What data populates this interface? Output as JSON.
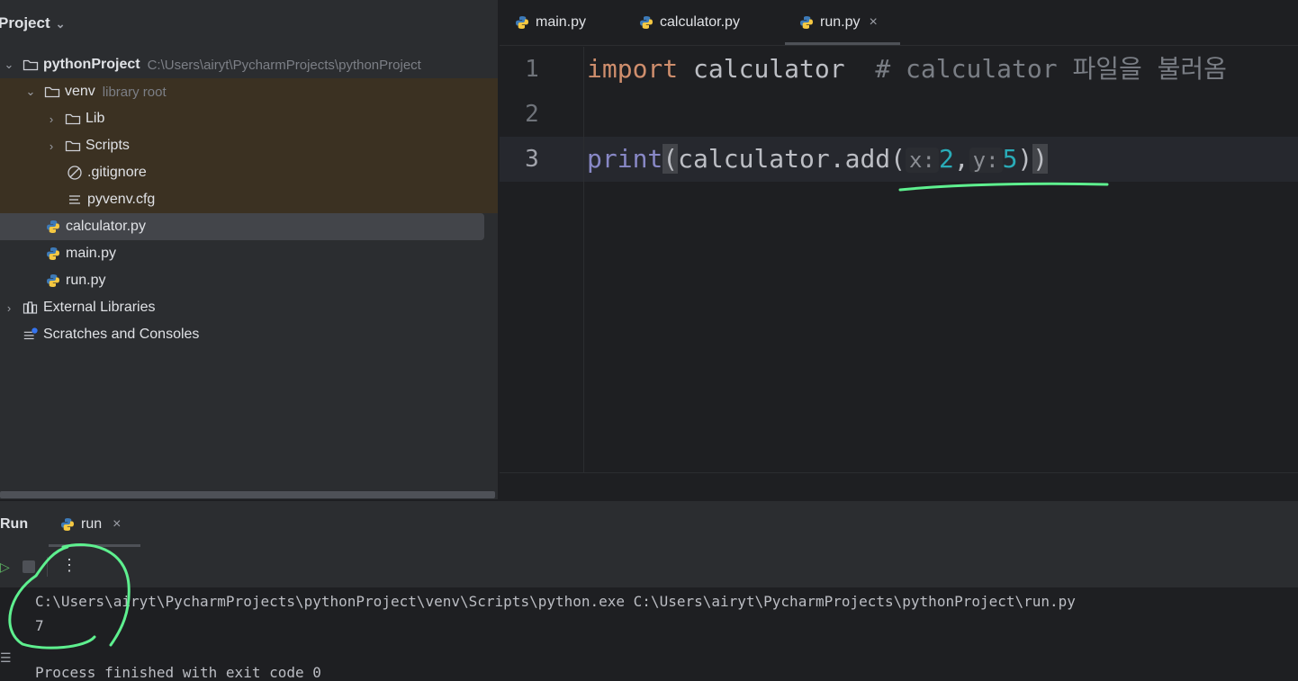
{
  "project_panel": {
    "title": "Project",
    "tree": {
      "root_name": "pythonProject",
      "root_path": "C:\\Users\\airyt\\PycharmProjects\\pythonProject",
      "venv_name": "venv",
      "venv_note": "library root",
      "lib": "Lib",
      "scripts": "Scripts",
      "gitignore": ".gitignore",
      "pyvenv": "pyvenv.cfg",
      "calculator": "calculator.py",
      "main": "main.py",
      "run": "run.py",
      "external_libraries": "External Libraries",
      "scratches": "Scratches and Consoles"
    }
  },
  "editor": {
    "tabs": [
      "main.py",
      "calculator.py",
      "run.py"
    ],
    "active_tab": "run.py",
    "line_numbers": [
      "1",
      "2",
      "3"
    ],
    "code": {
      "line1_keyword": "import",
      "line1_module": " calculator  ",
      "line1_comment": "# calculator 파일을 불러옴",
      "line3_print": "print",
      "line3_open": "(",
      "line3_call": "calculator.add(",
      "line3_hint_x": "x:",
      "line3_arg1": "2",
      "line3_comma": ",",
      "line3_hint_y": "y:",
      "line3_arg2": "5",
      "line3_close1": ")",
      "line3_close2": ")"
    }
  },
  "run_panel": {
    "title": "Run",
    "tab_label": "run",
    "more_label": "⋮",
    "console_lines": [
      "C:\\Users\\airyt\\PycharmProjects\\pythonProject\\venv\\Scripts\\python.exe C:\\Users\\airyt\\PycharmProjects\\pythonProject\\run.py",
      "7",
      "Process finished with exit code 0"
    ]
  },
  "colors": {
    "annotation": "#5ef08f",
    "python_blue": "#3d7ab8",
    "python_yellow": "#f5c842"
  }
}
